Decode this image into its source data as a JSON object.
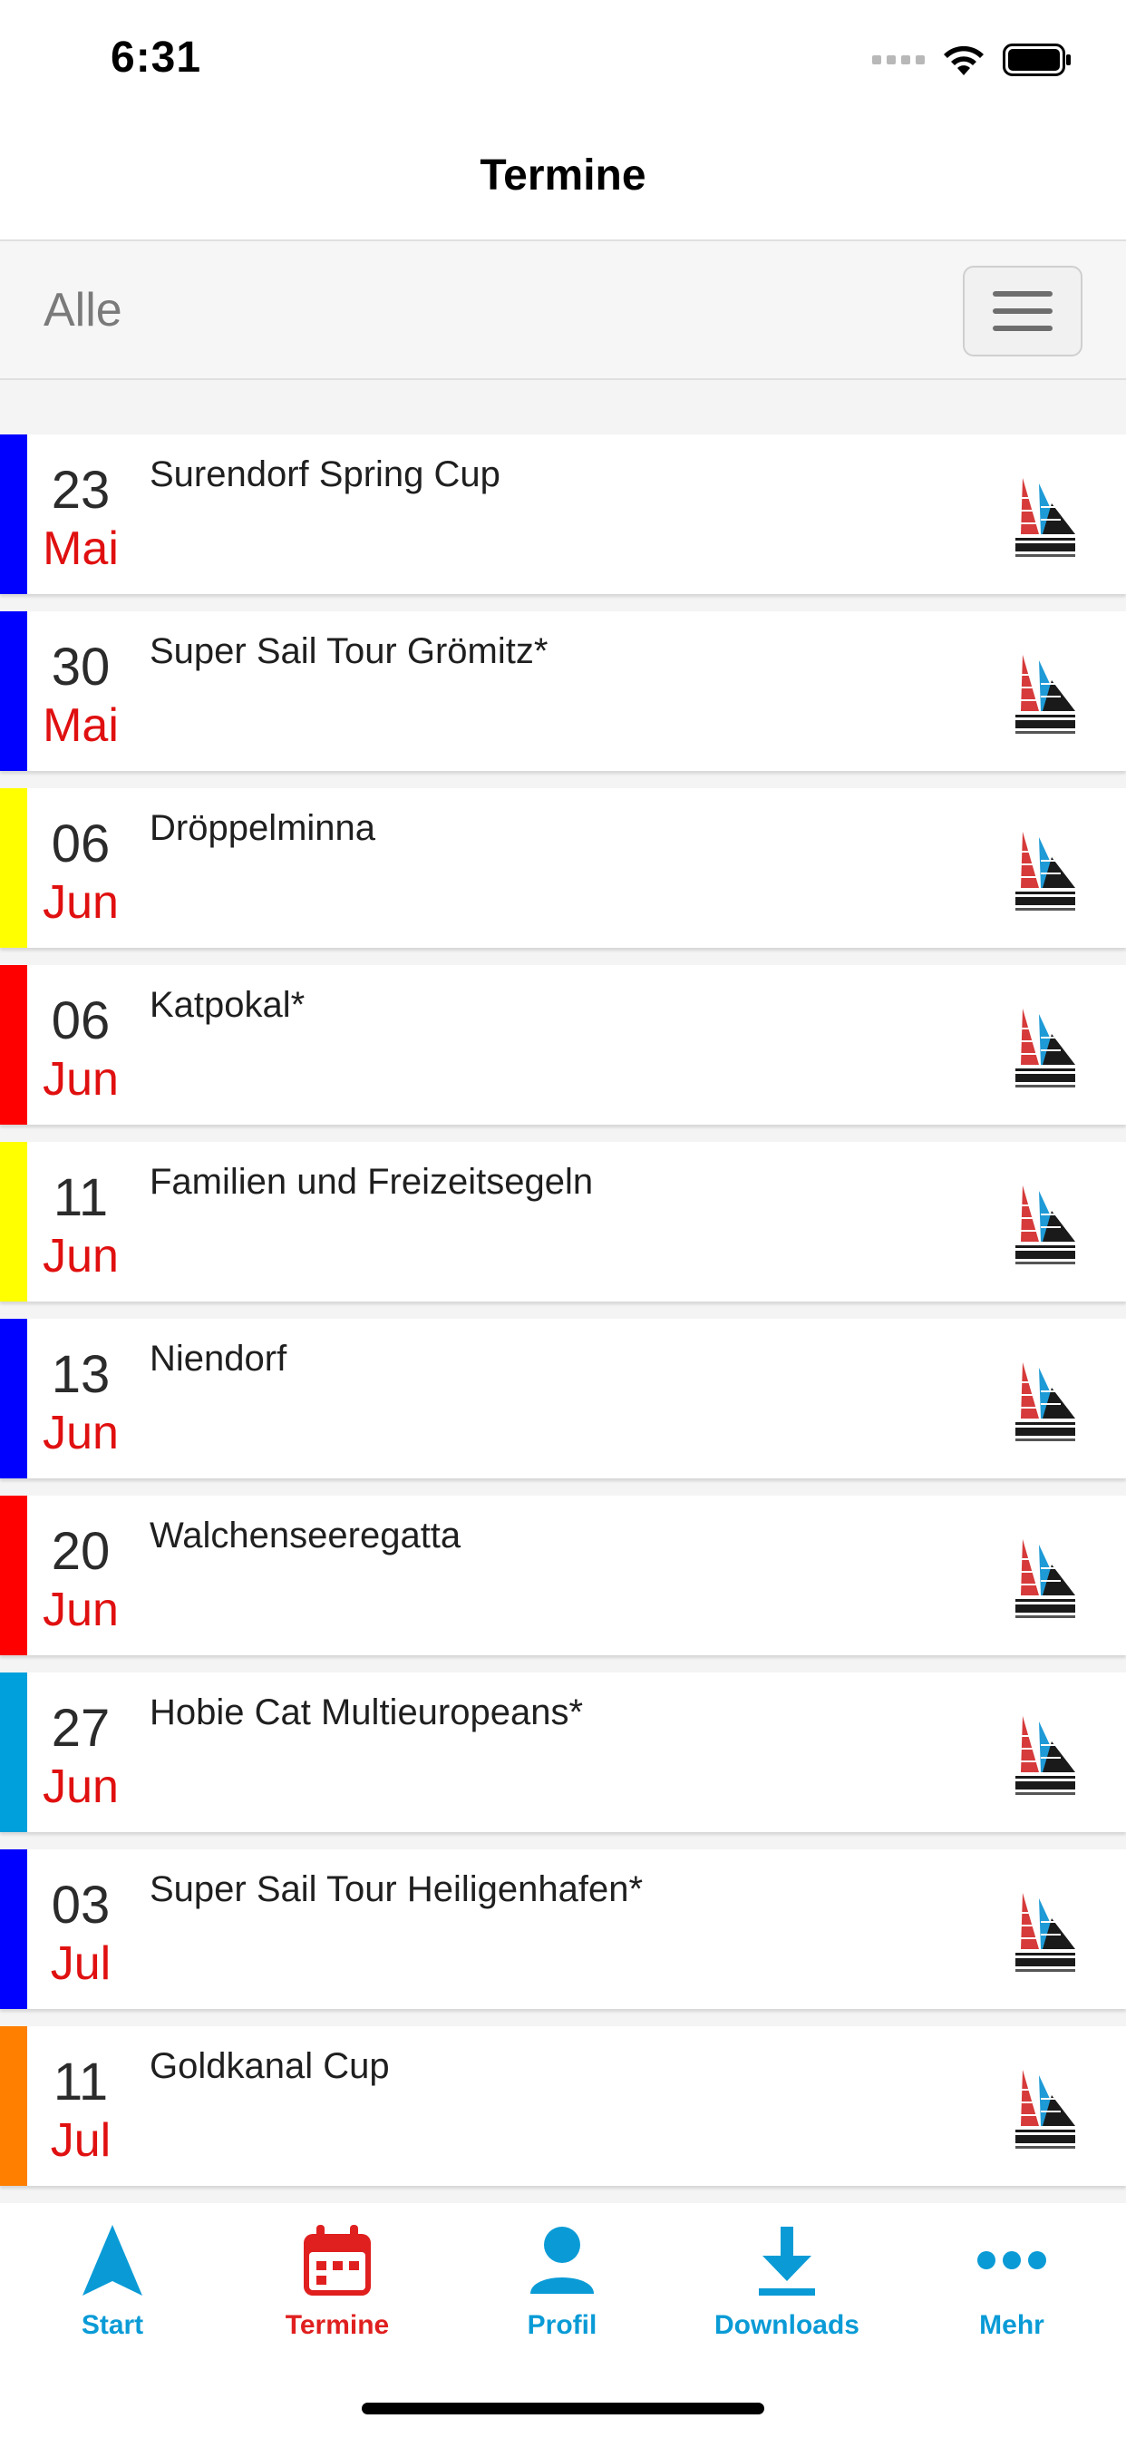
{
  "status_bar": {
    "time": "6:31"
  },
  "nav": {
    "title": "Termine"
  },
  "filter": {
    "label": "Alle",
    "menu_icon": "hamburger-menu-icon"
  },
  "colors": {
    "accent_blue": "#0a9bd6",
    "active_red": "#e01f1f",
    "month_red": "#e01010",
    "category_blue": "#0000ff",
    "category_yellow": "#ffff00",
    "category_red": "#ff0000",
    "category_lightblue": "#00a0dc",
    "category_orange": "#ff7f00"
  },
  "events": [
    {
      "day": "23",
      "month": "Mai",
      "name": "Surendorf Spring Cup",
      "color": "#0000ff",
      "logo": "hobie-cat-logo"
    },
    {
      "day": "30",
      "month": "Mai",
      "name": "Super Sail Tour Grömitz*",
      "color": "#0000ff",
      "logo": "hobie-cat-logo"
    },
    {
      "day": "06",
      "month": "Jun",
      "name": "Dröppelminna",
      "color": "#ffff00",
      "logo": "hobie-cat-logo"
    },
    {
      "day": "06",
      "month": "Jun",
      "name": "Katpokal*",
      "color": "#ff0000",
      "logo": "hobie-cat-logo"
    },
    {
      "day": "11",
      "month": "Jun",
      "name": "Familien und Freizeitsegeln",
      "color": "#ffff00",
      "logo": "hobie-cat-logo"
    },
    {
      "day": "13",
      "month": "Jun",
      "name": "Niendorf",
      "color": "#0000ff",
      "logo": "hobie-cat-logo"
    },
    {
      "day": "20",
      "month": "Jun",
      "name": "Walchenseeregatta",
      "color": "#ff0000",
      "logo": "hobie-cat-logo"
    },
    {
      "day": "27",
      "month": "Jun",
      "name": "Hobie Cat Multieuropeans*",
      "color": "#00a0dc",
      "logo": "hobie-cat-logo"
    },
    {
      "day": "03",
      "month": "Jul",
      "name": "Super Sail Tour Heiligenhafen*",
      "color": "#0000ff",
      "logo": "hobie-cat-logo"
    },
    {
      "day": "11",
      "month": "Jul",
      "name": "Goldkanal Cup",
      "color": "#ff7f00",
      "logo": "hobie-cat-logo"
    },
    {
      "day": "",
      "month": "",
      "name": "",
      "color": "#0000ff",
      "logo": "hobie-cat-logo"
    }
  ],
  "tabs": [
    {
      "label": "Start",
      "icon": "navigation-arrow-icon",
      "active": false
    },
    {
      "label": "Termine",
      "icon": "calendar-icon",
      "active": true
    },
    {
      "label": "Profil",
      "icon": "person-icon",
      "active": false
    },
    {
      "label": "Downloads",
      "icon": "download-icon",
      "active": false
    },
    {
      "label": "Mehr",
      "icon": "more-dots-icon",
      "active": false
    }
  ]
}
